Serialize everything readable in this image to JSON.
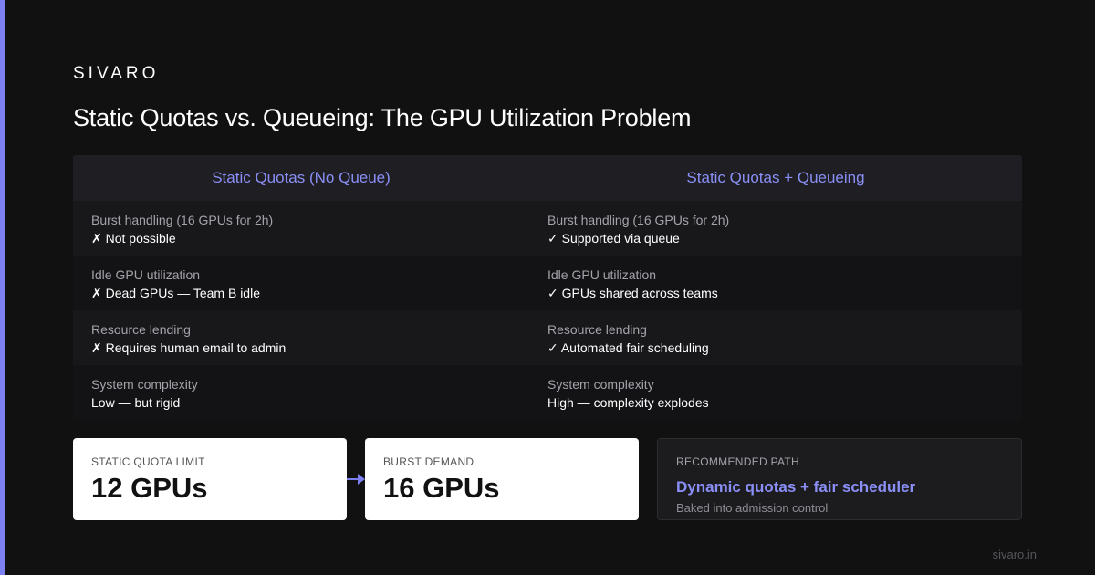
{
  "brand": "SIVARO",
  "title": "Static Quotas vs. Queueing: The GPU Utilization Problem",
  "table": {
    "headers": [
      "Static Quotas (No Queue)",
      "Static Quotas + Queueing"
    ],
    "rows": [
      {
        "left_label": "Burst handling (16 GPUs for 2h)",
        "left_value": "✗ Not possible",
        "right_label": "Burst handling (16 GPUs for 2h)",
        "right_value": "✓ Supported via queue"
      },
      {
        "left_label": "Idle GPU utilization",
        "left_value": "✗ Dead GPUs — Team B idle",
        "right_label": "Idle GPU utilization",
        "right_value": "✓ GPUs shared across teams"
      },
      {
        "left_label": "Resource lending",
        "left_value": "✗ Requires human email to admin",
        "right_label": "Resource lending",
        "right_value": "✓ Automated fair scheduling"
      },
      {
        "left_label": "System complexity",
        "left_value": "Low — but rigid",
        "right_label": "System complexity",
        "right_value": "High — complexity explodes"
      }
    ]
  },
  "cards": {
    "static": {
      "label": "STATIC QUOTA LIMIT",
      "value": "12 GPUs"
    },
    "burst": {
      "label": "BURST DEMAND",
      "value": "16 GPUs"
    },
    "recommended": {
      "label": "RECOMMENDED PATH",
      "title": "Dynamic quotas + fair scheduler",
      "subtitle": "Baked into admission control"
    }
  },
  "footer": "sivaro.in",
  "colors": {
    "accent": "#7c80f0",
    "header_text": "#8a8ff7",
    "background": "#111112"
  },
  "icons": {
    "arrow": "arrow-right-icon"
  }
}
